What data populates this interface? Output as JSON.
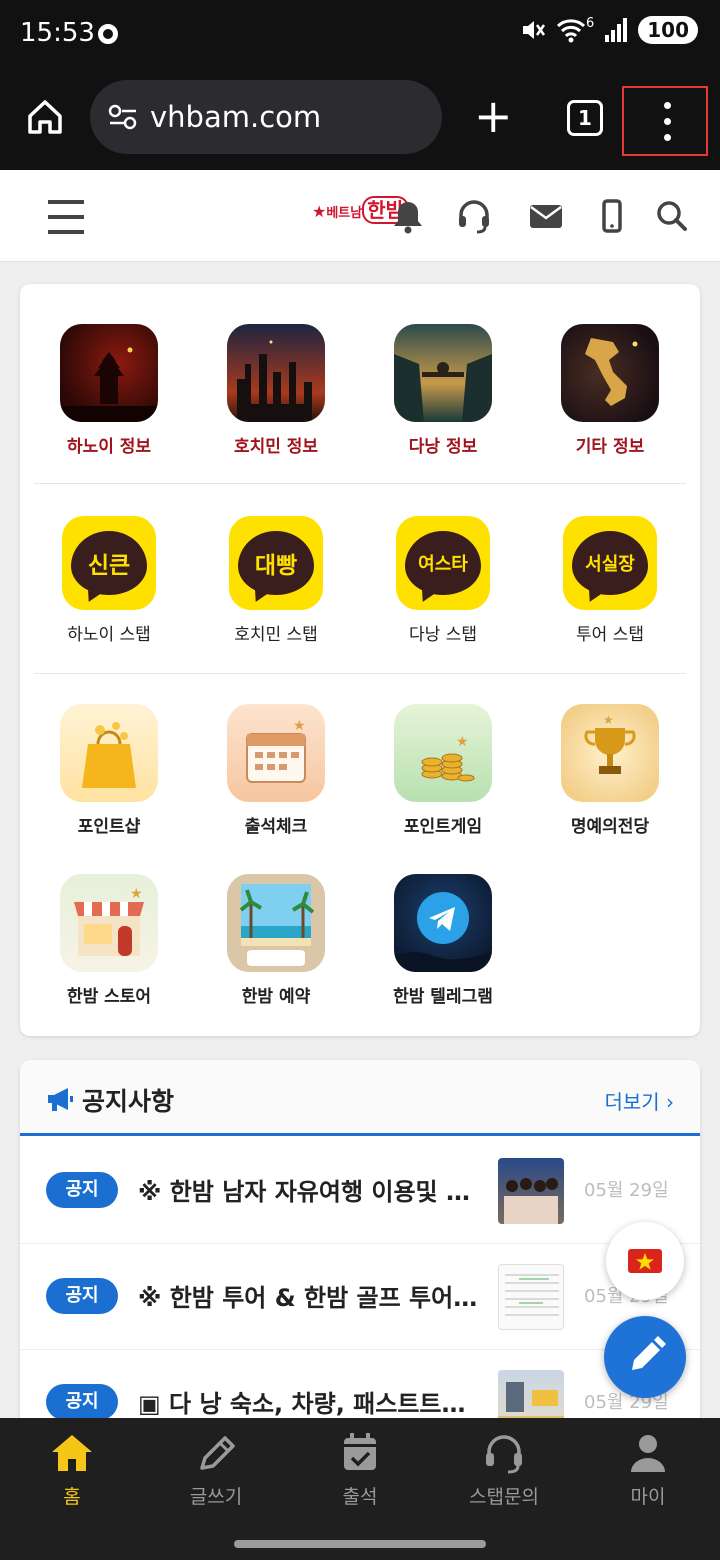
{
  "status": {
    "time": "15:53",
    "battery": "100",
    "signal_label": "6"
  },
  "browser": {
    "url": "vhbam.com",
    "tab_count": "1"
  },
  "header": {
    "logo_sub": "베트남",
    "logo_main": "한밤"
  },
  "grid": {
    "row1": [
      {
        "label": "하노이 정보",
        "icon": "pagoda-night-icon"
      },
      {
        "label": "호치민 정보",
        "icon": "city-night-icon"
      },
      {
        "label": "다낭 정보",
        "icon": "bridge-night-icon"
      },
      {
        "label": "기타 정보",
        "icon": "vietnam-map-icon"
      }
    ],
    "row2": [
      {
        "label": "하노이 스탭",
        "bubble": "신큰"
      },
      {
        "label": "호치민 스탭",
        "bubble": "대빵"
      },
      {
        "label": "다낭 스탭",
        "bubble": "여스타"
      },
      {
        "label": "투어 스탭",
        "bubble": "서실장"
      }
    ],
    "row3": [
      {
        "label": "포인트샵",
        "icon": "shopping-bag-icon"
      },
      {
        "label": "출석체크",
        "icon": "calendar-icon"
      },
      {
        "label": "포인트게임",
        "icon": "coins-icon"
      },
      {
        "label": "명예의전당",
        "icon": "trophy-icon"
      }
    ],
    "row4": [
      {
        "label": "한밤 스토어",
        "icon": "storefront-icon"
      },
      {
        "label": "한밤 예약",
        "icon": "beach-window-icon"
      },
      {
        "label": "한밤 텔레그램",
        "icon": "telegram-icon"
      }
    ]
  },
  "notice": {
    "title": "공지사항",
    "more": "더보기",
    "items": [
      {
        "badge": "공지",
        "title": "※ 한밤 남자 자유여행 이용및 …",
        "date": "05월 29일"
      },
      {
        "badge": "공지",
        "title": "※ 한밤 투어 & 한밤 골프 투어 ※",
        "date": "05월 29일"
      },
      {
        "badge": "공지",
        "title": "▣ 다 낭 숙소, 차량, 패스트트…",
        "date": "05월 29일"
      }
    ]
  },
  "bottom_nav": [
    {
      "label": "홈",
      "active": true
    },
    {
      "label": "글쓰기"
    },
    {
      "label": "출석"
    },
    {
      "label": "스탭문의"
    },
    {
      "label": "마이"
    }
  ],
  "colors": {
    "accent": "#1a6fd1",
    "brand_red": "#d2152f",
    "kakao_yellow": "#ffe100",
    "active_nav": "#f5c518"
  }
}
